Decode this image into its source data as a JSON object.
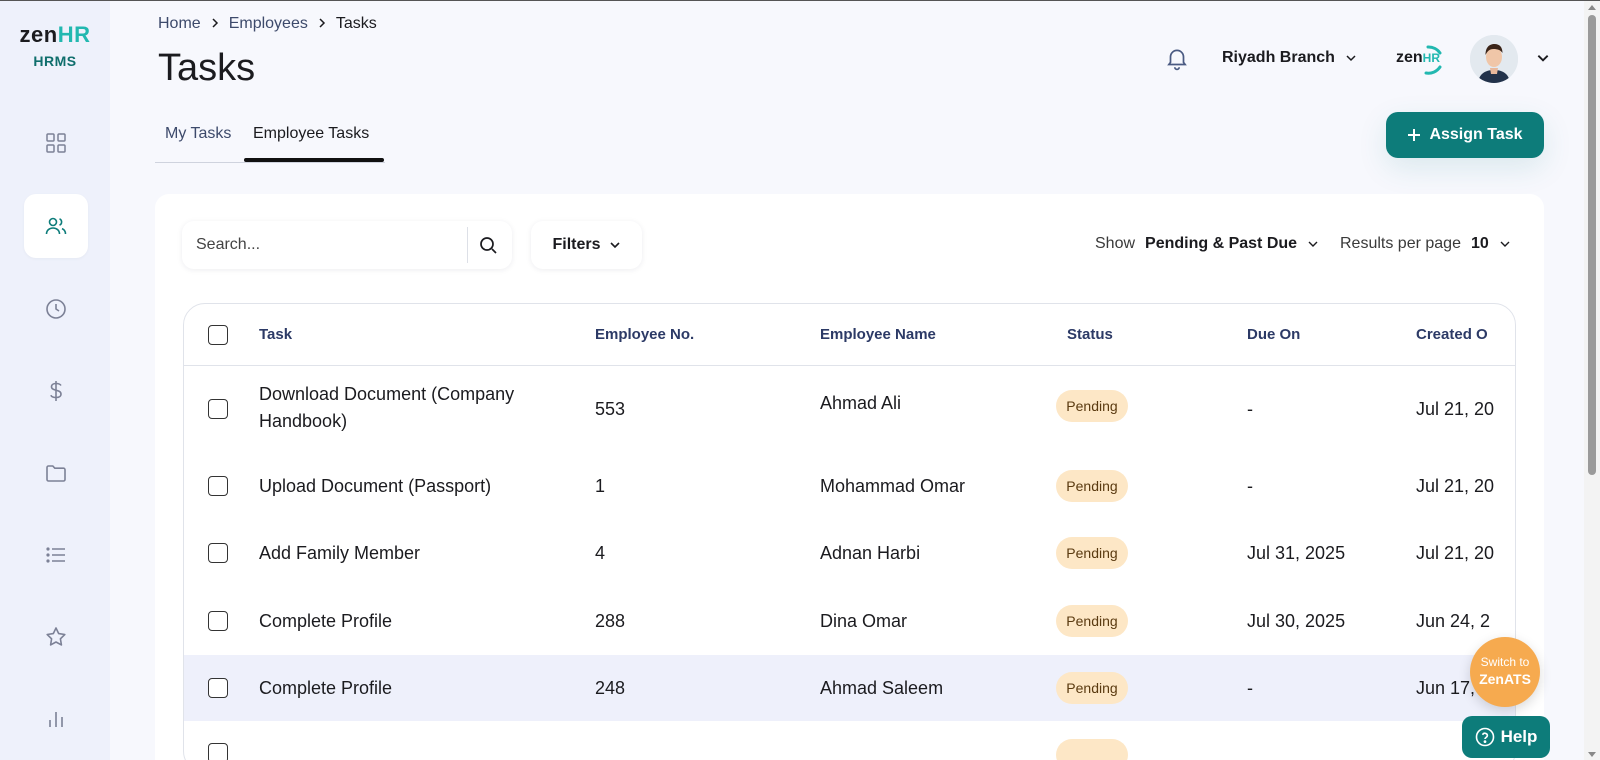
{
  "app": {
    "logo_zen": "zen",
    "logo_hr": "HR",
    "logo_sub": "HRMS"
  },
  "sidebar": {
    "items": [
      {
        "icon": "grid-icon",
        "active": false
      },
      {
        "icon": "users-icon",
        "active": true
      },
      {
        "icon": "clock-icon",
        "active": false
      },
      {
        "icon": "dollar-icon",
        "active": false
      },
      {
        "icon": "folder-icon",
        "active": false
      },
      {
        "icon": "list-icon",
        "active": false
      },
      {
        "icon": "star-icon",
        "active": false
      },
      {
        "icon": "bar-chart-icon",
        "active": false
      }
    ]
  },
  "breadcrumb": {
    "items": [
      "Home",
      "Employees",
      "Tasks"
    ]
  },
  "page": {
    "title": "Tasks"
  },
  "header": {
    "branch": "Riyadh Branch",
    "brand_zen": "zen",
    "brand_hr": "HR"
  },
  "tabs": {
    "my_tasks": "My Tasks",
    "employee_tasks": "Employee Tasks",
    "active": "Employee Tasks"
  },
  "actions": {
    "assign_task": "Assign Task"
  },
  "toolbar": {
    "search_placeholder": "Search...",
    "filters_label": "Filters",
    "show_label": "Show",
    "show_value": "Pending & Past Due",
    "rpp_label": "Results per page",
    "rpp_value": "10"
  },
  "table": {
    "columns": [
      "Task",
      "Employee No.",
      "Employee Name",
      "Status",
      "Due On",
      "Created O"
    ],
    "rows": [
      {
        "task": "Download Document (Company Handbook)",
        "emp_no": "553",
        "emp_name": "Ahmad Ali",
        "status": "Pending",
        "due": "-",
        "created": "Jul 21, 20"
      },
      {
        "task": "Upload Document (Passport)",
        "emp_no": "1",
        "emp_name": "Mohammad Omar",
        "status": "Pending",
        "due": "-",
        "created": "Jul 21, 20"
      },
      {
        "task": "Add Family Member",
        "emp_no": "4",
        "emp_name": "Adnan Harbi",
        "status": "Pending",
        "due": "Jul 31, 2025",
        "created": "Jul 21, 20"
      },
      {
        "task": "Complete Profile",
        "emp_no": "288",
        "emp_name": "Dina Omar",
        "status": "Pending",
        "due": "Jul 30, 2025",
        "created": "Jun 24, 2"
      },
      {
        "task": "Complete Profile",
        "emp_no": "248",
        "emp_name": "Ahmad Saleem",
        "status": "Pending",
        "due": "-",
        "created": "Jun 17, 2"
      }
    ]
  },
  "floating": {
    "switch_line1": "Switch to",
    "switch_line2": "ZenATS",
    "help": "Help"
  },
  "colors": {
    "accent": "#0d7c7a",
    "pending_bg": "#fde7c6",
    "sidebar_bg": "#eef1fb",
    "switch_bg": "#f6aa4f"
  }
}
